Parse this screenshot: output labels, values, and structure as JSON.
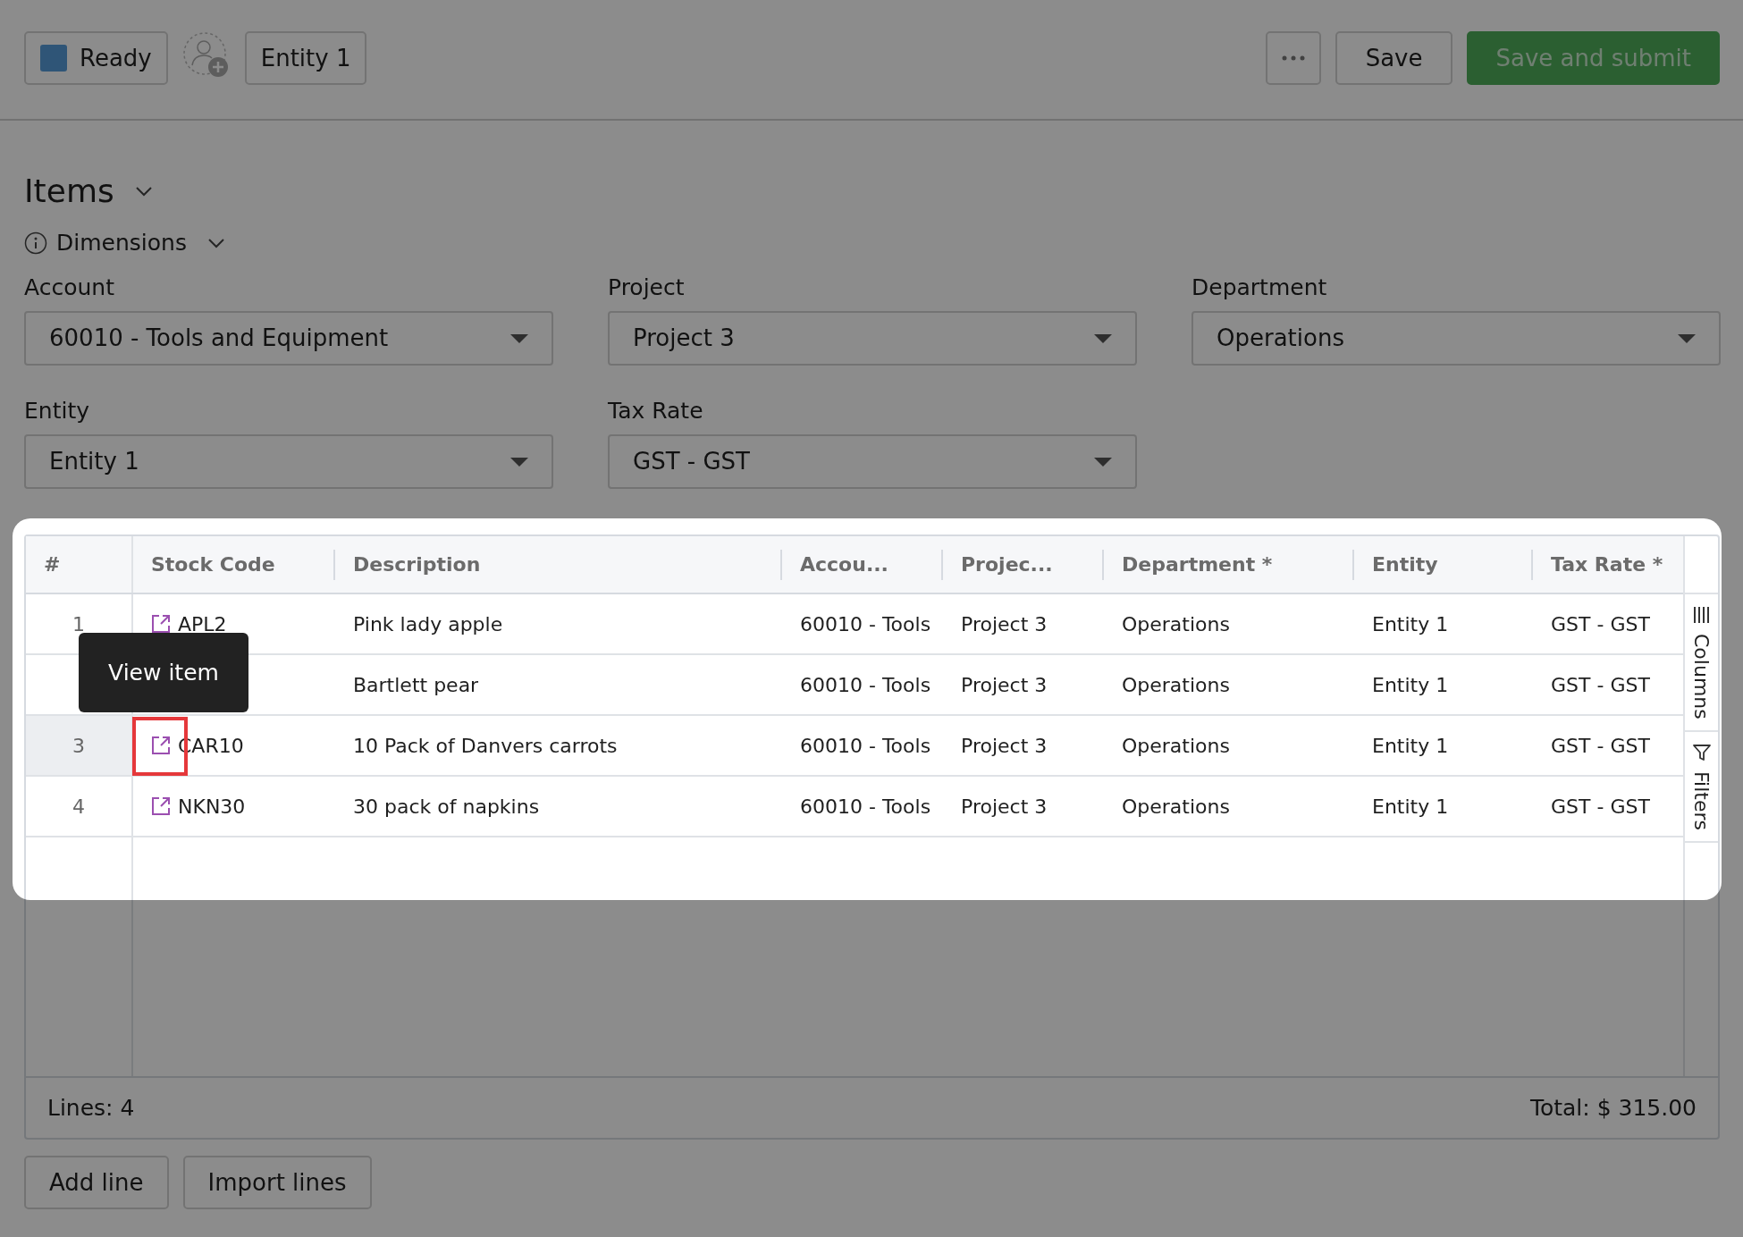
{
  "toolbar": {
    "status": {
      "label": "Ready",
      "color": "#2f5577"
    },
    "entity_chip": "Entity 1",
    "save": "Save",
    "submit": "Save and submit"
  },
  "section": {
    "title": "Items",
    "expanded": true
  },
  "dimensions": {
    "label": "Dimensions",
    "expanded": true
  },
  "fields": [
    {
      "label": "Account",
      "value": "60010 - Tools and Equipment"
    },
    {
      "label": "Project",
      "value": "Project 3"
    },
    {
      "label": "Department",
      "value": "Operations"
    },
    {
      "label": "Entity",
      "value": "Entity 1"
    },
    {
      "label": "Tax Rate",
      "value": "GST - GST"
    }
  ],
  "table": {
    "columns": [
      "#",
      "Stock Code",
      "Description",
      "Accou...",
      "Projec...",
      "Department *",
      "Entity",
      "Tax Rate *"
    ],
    "rows": [
      {
        "number": "1",
        "stock_code": "APL2",
        "description": "Pink lady apple",
        "account": "60010 - Tools",
        "project": "Project 3",
        "department": "Operations",
        "entity": "Entity 1",
        "tax_rate": "GST - GST",
        "hovered": false
      },
      {
        "stock_code": "",
        "description": "Bartlett pear",
        "account": "60010 - Tools",
        "project": "Project 3",
        "department": "Operations",
        "entity": "Entity 1",
        "tax_rate": "GST - GST",
        "hovered": false
      },
      {
        "number": "3",
        "stock_code": "CAR10",
        "description": "10 Pack of Danvers carrots",
        "account": "60010 - Tools",
        "project": "Project 3",
        "department": "Operations",
        "entity": "Entity 1",
        "tax_rate": "GST - GST",
        "hovered": true
      },
      {
        "number": "4",
        "stock_code": "NKN30",
        "description": "30 pack of napkins",
        "account": "60010 - Tools",
        "project": "Project 3",
        "department": "Operations",
        "entity": "Entity 1",
        "tax_rate": "GST - GST",
        "hovered": false
      }
    ],
    "side_tabs": [
      {
        "kind": "columns",
        "label": "Columns"
      },
      {
        "kind": "filters",
        "label": "Filters"
      }
    ],
    "lines": "Lines: 4",
    "total": "Total: $ 315.00"
  },
  "tooltip": "View item",
  "buttons": [
    "Add line",
    "Import lines"
  ]
}
